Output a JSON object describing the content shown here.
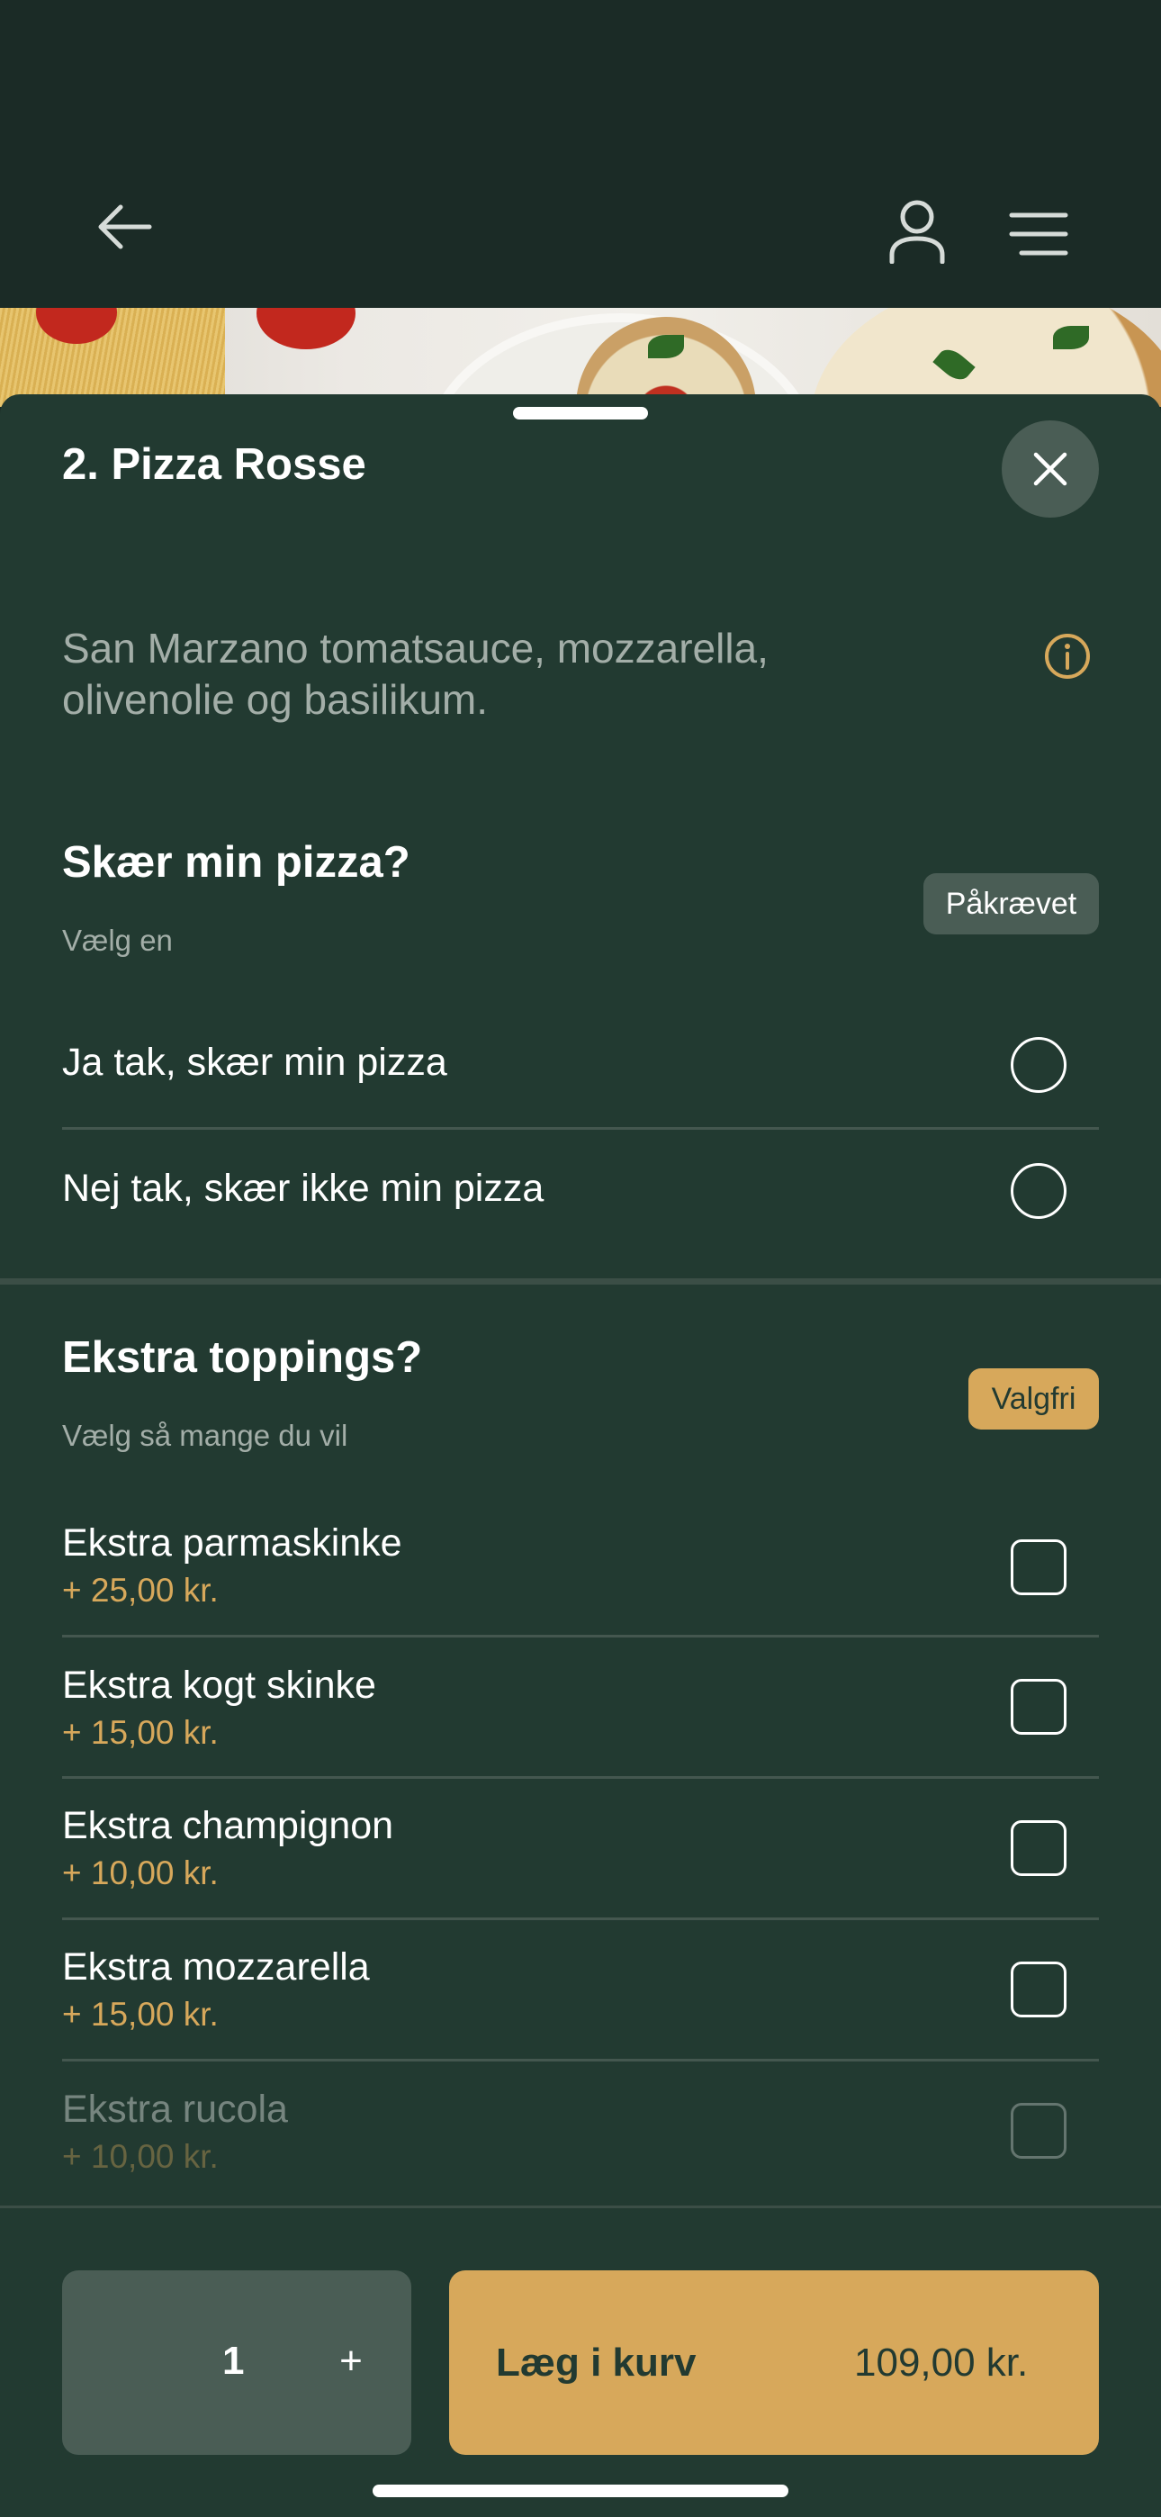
{
  "header": {
    "back_icon": "arrow-left-icon",
    "account_icon": "user-icon",
    "menu_icon": "hamburger-menu-icon"
  },
  "product": {
    "title": "2. Pizza Rosse",
    "description": "San Marzano tomatsauce, mozzarella, olivenolie og basilikum.",
    "close_icon": "close-icon",
    "info_icon": "info-icon"
  },
  "cut_group": {
    "title": "Skær min pizza?",
    "subtitle": "Vælg en",
    "badge": "Påkrævet",
    "options": [
      {
        "label": "Ja tak, skær min pizza",
        "selected": false
      },
      {
        "label": "Nej tak, skær ikke min pizza",
        "selected": false
      }
    ]
  },
  "toppings_group": {
    "title": "Ekstra toppings?",
    "subtitle": "Vælg så mange du vil",
    "badge": "Valgfri",
    "options": [
      {
        "label": "Ekstra parmaskinke",
        "price": "+ 25,00 kr.",
        "checked": false
      },
      {
        "label": "Ekstra kogt skinke",
        "price": "+ 15,00 kr.",
        "checked": false
      },
      {
        "label": "Ekstra champignon",
        "price": "+ 10,00 kr.",
        "checked": false
      },
      {
        "label": "Ekstra mozzarella",
        "price": "+ 15,00 kr.",
        "checked": false
      },
      {
        "label": "Ekstra rucola",
        "price": "+ 10,00 kr.",
        "checked": false
      }
    ]
  },
  "footer": {
    "quantity": "1",
    "plus_label": "+",
    "add_label": "Læg i kurv",
    "total": "109,00 kr."
  },
  "colors": {
    "background": "#1b2b26",
    "sheet": "#223a31",
    "accent": "#d7a85b",
    "muted": "#4a5d55"
  }
}
